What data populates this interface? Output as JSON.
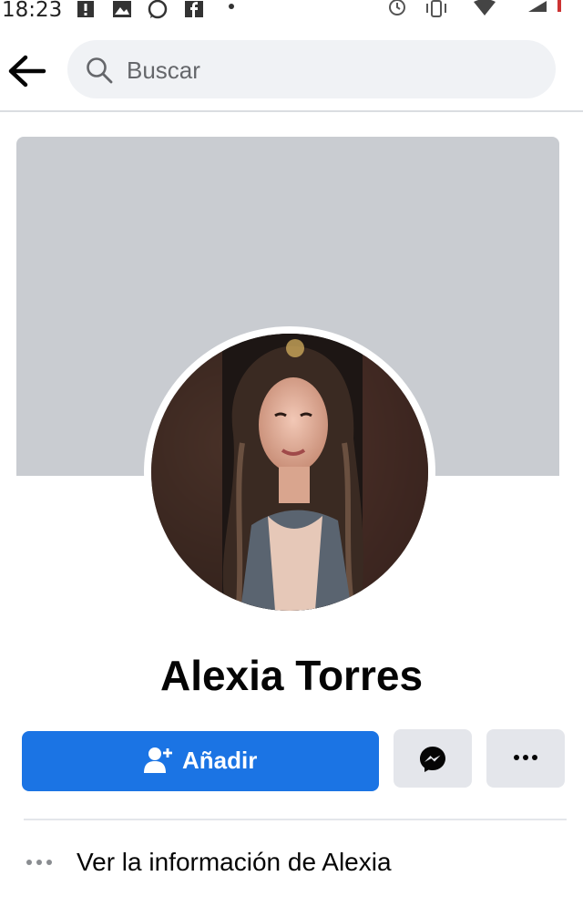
{
  "status_bar": {
    "time": "18:23",
    "icons": [
      "alert-icon",
      "image-icon",
      "whatsapp-icon",
      "facebook-icon",
      "dot-icon",
      "alarm-icon",
      "vibrate-icon",
      "wifi-icon",
      "signal-icon"
    ]
  },
  "header": {
    "back_icon": "arrow-left-icon",
    "search_placeholder": "Buscar"
  },
  "profile": {
    "name": "Alexia Torres",
    "cover_color": "#c9ccd1",
    "avatar_alt": "profile photo"
  },
  "actions": {
    "add_label": "Añadir",
    "add_icon": "add-friend-icon",
    "message_icon": "messenger-icon",
    "more_icon": "more-icon",
    "primary_color": "#1b74e4",
    "secondary_color": "#e4e6eb"
  },
  "info": {
    "label": "Ver la información de Alexia",
    "icon": "more-dots-icon"
  }
}
